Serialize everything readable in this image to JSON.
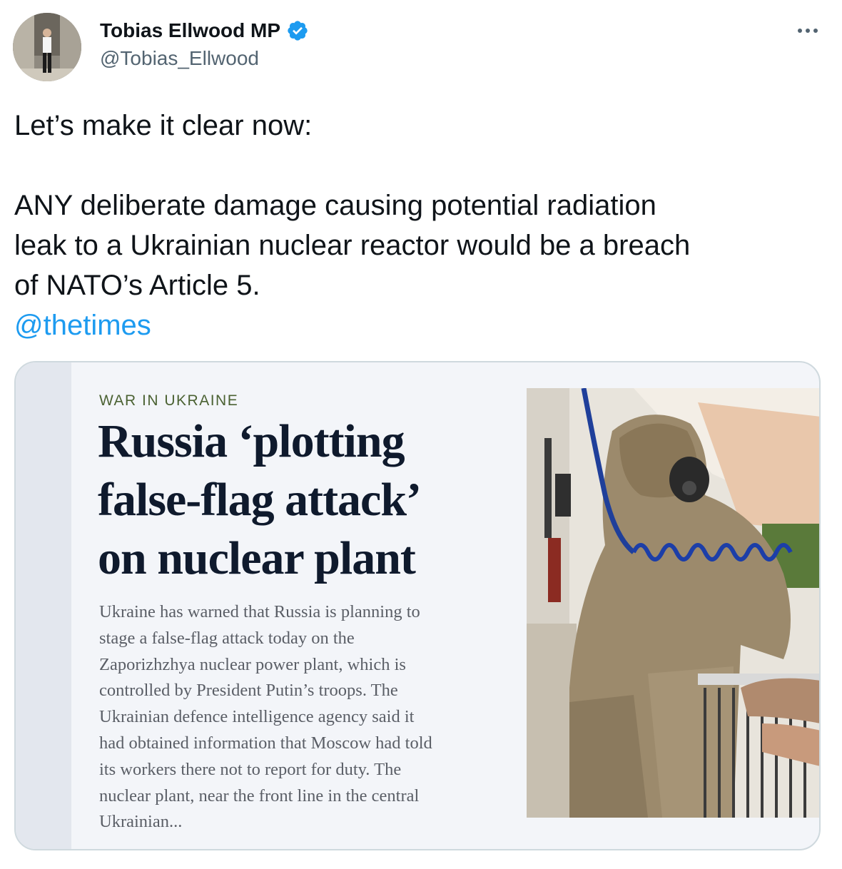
{
  "author": {
    "name": "Tobias Ellwood MP",
    "handle": "@Tobias_Ellwood",
    "verified": true,
    "avatar_icon": "person-portrait"
  },
  "menu_icon": "more-dots-icon",
  "tweet": {
    "line1": "Let’s make it clear now:",
    "paragraph_lines": [
      "ANY deliberate damage causing potential radiation",
      "leak to a Ukrainian nuclear reactor would be a breach",
      "of NATO’s Article 5."
    ],
    "mention": "@thetimes"
  },
  "article": {
    "kicker": "WAR IN UKRAINE",
    "headline_lines": [
      "Russia ‘plotting",
      "false-flag attack’",
      "on nuclear plant"
    ],
    "summary_lines": [
      "Ukraine has warned that Russia is planning to",
      "stage a false-flag attack today on the",
      "Zaporizhzhya nuclear power plant, which is",
      "controlled by President Putin’s troops. The",
      "Ukrainian defence intelligence agency said it",
      "had obtained information that Moscow had told",
      "its workers there not to report for duty. The",
      "nuclear plant, near the front line in the central",
      "Ukrainian..."
    ],
    "photo_subject": "person-in-hazmat-suit-with-coiled-hose"
  },
  "colors": {
    "text": "#0f1419",
    "secondary": "#536471",
    "link": "#1d9bf0",
    "verified": "#1d9bf0",
    "card_border": "#cfd9de",
    "headline": "#0f1a2d",
    "kicker": "#4b6233"
  }
}
